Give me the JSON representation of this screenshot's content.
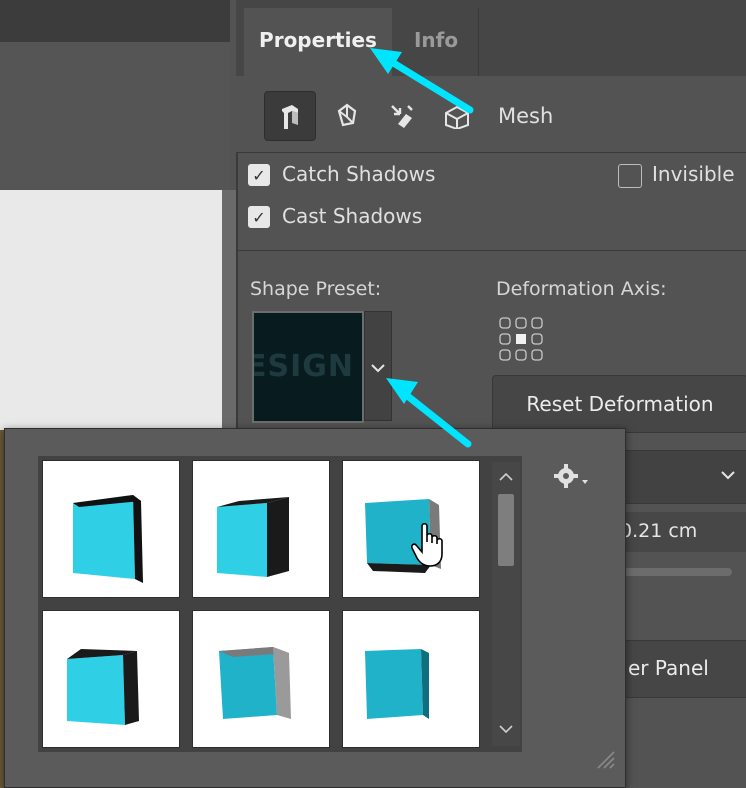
{
  "panel": {
    "tabs": [
      {
        "label": "Properties",
        "active": true
      },
      {
        "label": "Info",
        "active": false
      }
    ],
    "toolbar": {
      "icons": [
        "mesh-icon",
        "deform-icon",
        "cap-icon",
        "coordinates-icon"
      ],
      "mode_label": "Mesh"
    },
    "options": {
      "catch_shadows": {
        "label": "Catch Shadows",
        "checked": true
      },
      "cast_shadows": {
        "label": "Cast Shadows",
        "checked": true
      },
      "invisible": {
        "label": "Invisible",
        "checked": false
      }
    },
    "shape_preset": {
      "label": "Shape Preset:",
      "swatch_text": "ESIGN"
    },
    "deformation_axis": {
      "label": "Deformation Axis:"
    },
    "reset_button": "Reset Deformation",
    "partial": {
      "value": "0.21 cm",
      "button": "er Panel"
    }
  },
  "popup": {
    "presets": [
      {
        "name": "preset-1"
      },
      {
        "name": "preset-2"
      },
      {
        "name": "preset-3"
      },
      {
        "name": "preset-4"
      },
      {
        "name": "preset-5"
      },
      {
        "name": "preset-6"
      }
    ],
    "gear_icon": "gear-icon"
  },
  "colors": {
    "accent_arrow": "#00e5ff",
    "cube_face": "#2fd0e6",
    "panel_bg": "#535353"
  }
}
